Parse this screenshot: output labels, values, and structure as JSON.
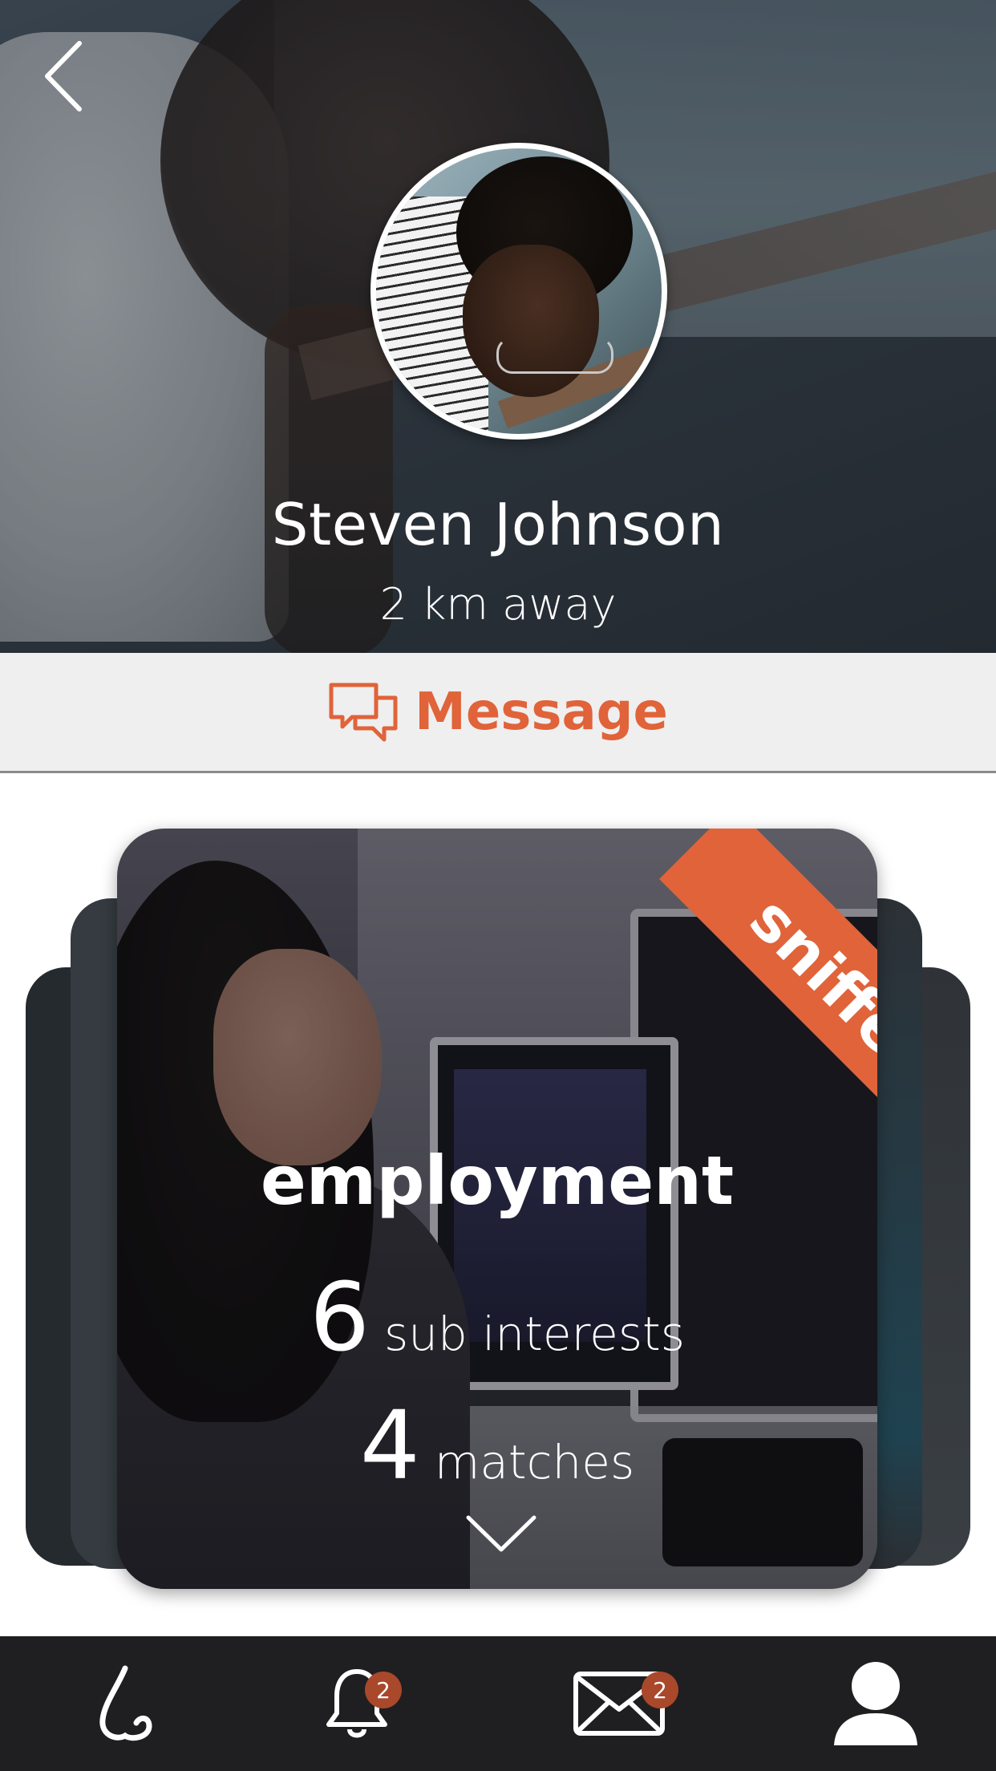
{
  "colors": {
    "accent": "#e0633a",
    "badge": "#a9482b",
    "tabbar": "#1f1f21",
    "message_bar": "#efefef"
  },
  "header": {
    "back_icon": "chevron-left-icon"
  },
  "profile": {
    "name": "Steven Johnson",
    "distance": "2 km away"
  },
  "message_button": {
    "label": "Message",
    "icon": "chat-bubbles-icon"
  },
  "interest_card": {
    "ribbon": "sniffed!",
    "title": "employment",
    "sub_interests_count": "6",
    "sub_interests_label": "sub interests",
    "matches_count": "4",
    "matches_label": "matches",
    "expand_icon": "chevron-down-icon"
  },
  "tabbar": {
    "items": [
      {
        "name": "sniff",
        "icon": "nose-icon"
      },
      {
        "name": "notifications",
        "icon": "bell-icon",
        "badge": "2"
      },
      {
        "name": "messages",
        "icon": "envelope-icon",
        "badge": "2"
      },
      {
        "name": "profile",
        "icon": "user-icon"
      }
    ]
  }
}
